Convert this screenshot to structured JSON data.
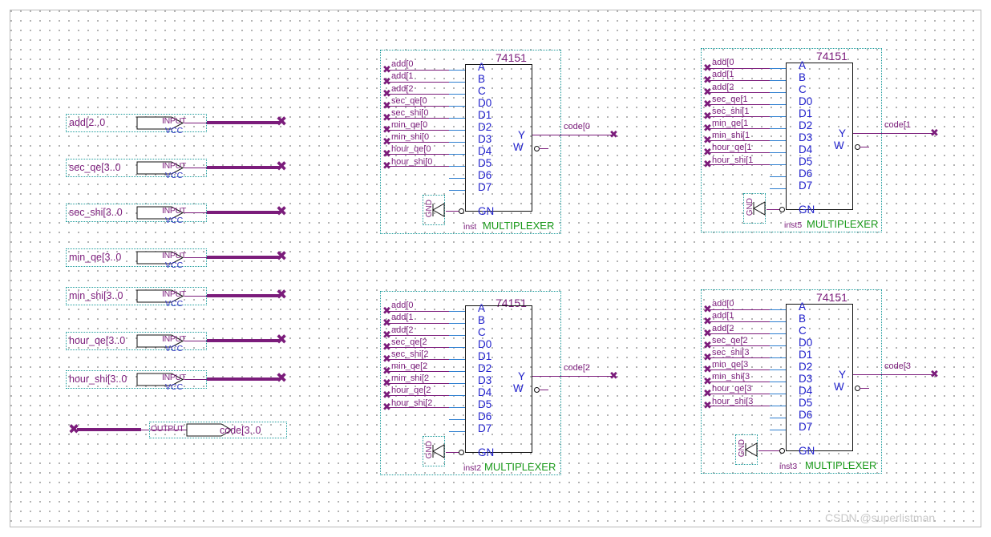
{
  "app": {
    "watermark": "CSDN @superlistman"
  },
  "input_pins": [
    {
      "label": "add[2..0",
      "kind": "INPUT",
      "power": "VCC"
    },
    {
      "label": "sec_qe[3..0",
      "kind": "INPUT",
      "power": "VCC"
    },
    {
      "label": "sec_shi[3..0",
      "kind": "INPUT",
      "power": "VCC"
    },
    {
      "label": "min_qe[3..0",
      "kind": "INPUT",
      "power": "VCC"
    },
    {
      "label": "min_shi[3..0",
      "kind": "INPUT",
      "power": "VCC"
    },
    {
      "label": "hour_qe[3..0",
      "kind": "INPUT",
      "power": "VCC"
    },
    {
      "label": "hour_shi[3..0",
      "kind": "INPUT",
      "power": "VCC"
    }
  ],
  "output_pin": {
    "label": "code[3..0",
    "kind": "OUTPUT"
  },
  "chip_ports": [
    "A",
    "B",
    "C",
    "D0",
    "D1",
    "D2",
    "D3",
    "D4",
    "D5",
    "D6",
    "D7",
    "GN"
  ],
  "chips": [
    {
      "title": "74151",
      "instance": "inst",
      "type": "MULTIPLEXER",
      "gnd_label": "GND",
      "out_y_label": "Y",
      "out_w_label": "W",
      "output_net": "code[0",
      "input_nets": [
        "add[0",
        "add[1",
        "add[2",
        "sec_qe[0",
        "sec_shi[0",
        "min_qe[0",
        "min_shi[0",
        "hour_qe[0",
        "hour_shi[0"
      ]
    },
    {
      "title": "74151",
      "instance": "inst5",
      "type": "MULTIPLEXER",
      "gnd_label": "GND",
      "out_y_label": "Y",
      "out_w_label": "W",
      "output_net": "code[1",
      "input_nets": [
        "add[0",
        "add[1",
        "add[2",
        "sec_qe[1",
        "sec_shi[1",
        "min_qe[1",
        "min_shi[1",
        "hour_qe[1",
        "hour_shi[1"
      ]
    },
    {
      "title": "74151",
      "instance": "inst2",
      "type": "MULTIPLEXER",
      "gnd_label": "GND",
      "out_y_label": "Y",
      "out_w_label": "W",
      "output_net": "code[2",
      "input_nets": [
        "add[0",
        "add[1",
        "add[2",
        "sec_qe[2",
        "sec_shi[2",
        "min_qe[2",
        "min_shi[2",
        "hour_qe[2",
        "hour_shi[2"
      ]
    },
    {
      "title": "74151",
      "instance": "inst3",
      "type": "MULTIPLEXER",
      "gnd_label": "GND",
      "out_y_label": "Y",
      "out_w_label": "W",
      "output_net": "code[3",
      "input_nets": [
        "add[0",
        "add[1",
        "add[2",
        "sec_qe[2",
        "sec_shi[3",
        "min_qe[3",
        "min_shi[3",
        "hour_qe[3",
        "hour_shi[3"
      ]
    }
  ],
  "colors": {
    "wire": "#7b1c7b",
    "pin_line": "#2f7fd0",
    "port_text": "#2222cc",
    "type_text": "#1a9a1a",
    "selection": "#1c9c9c",
    "grid_dot": "#9a9a9a"
  }
}
